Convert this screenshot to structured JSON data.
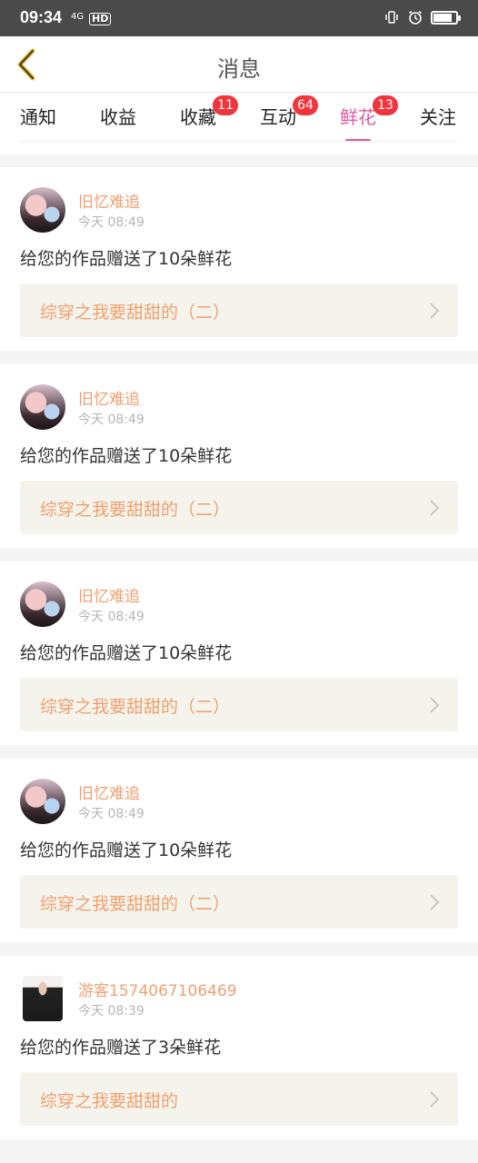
{
  "status": {
    "time": "09:34",
    "network": "4G",
    "hd": "HD",
    "battery_level": 0.85
  },
  "header": {
    "title": "消息"
  },
  "tabs": [
    {
      "label": "通知",
      "badge": ""
    },
    {
      "label": "收益",
      "badge": ""
    },
    {
      "label": "收藏",
      "badge": "11"
    },
    {
      "label": "互动",
      "badge": "64"
    },
    {
      "label": "鲜花",
      "badge": "13",
      "active": true
    },
    {
      "label": "关注",
      "badge": ""
    }
  ],
  "messages": [
    {
      "user": "旧忆难追",
      "time": "今天 08:49",
      "text": "给您的作品赠送了10朵鲜花",
      "work": "综穿之我要甜甜的（二）"
    },
    {
      "user": "旧忆难追",
      "time": "今天 08:49",
      "text": "给您的作品赠送了10朵鲜花",
      "work": "综穿之我要甜甜的（二）"
    },
    {
      "user": "旧忆难追",
      "time": "今天 08:49",
      "text": "给您的作品赠送了10朵鲜花",
      "work": "综穿之我要甜甜的（二）"
    },
    {
      "user": "旧忆难追",
      "time": "今天 08:49",
      "text": "给您的作品赠送了10朵鲜花",
      "work": "综穿之我要甜甜的（二）"
    },
    {
      "user": "游客1574067106469",
      "time": "今天 08:39",
      "text": "给您的作品赠送了3朵鲜花",
      "work": "综穿之我要甜甜的"
    }
  ],
  "colors": {
    "accent": "#e05a9a",
    "username": "#f0a070",
    "badge": "#f0353d",
    "work_bg": "#f5f4ec"
  }
}
